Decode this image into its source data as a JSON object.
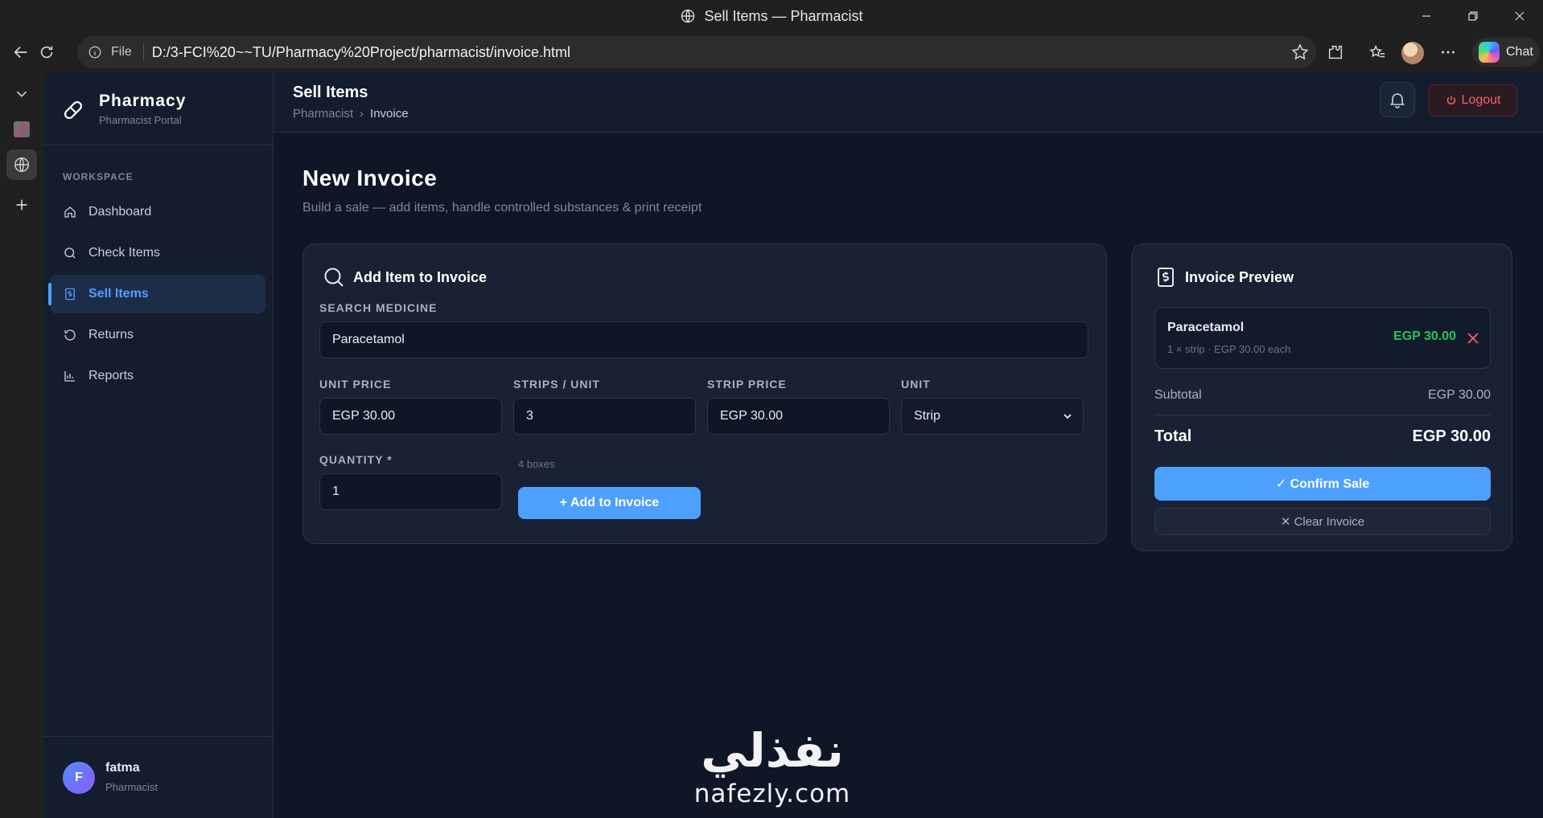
{
  "browser": {
    "window_title": "Sell Items — Pharmacist",
    "scheme_label": "File",
    "url": "D:/3-FCI%20~~TU/Pharmacy%20Project/pharmacist/invoice.html",
    "chat_label": "Chat"
  },
  "brand": {
    "name": "Pharmacy",
    "subtitle": "Pharmacist Portal"
  },
  "sidebar": {
    "section_label": "WORKSPACE",
    "items": [
      {
        "label": "Dashboard",
        "icon": "home-icon",
        "active": false
      },
      {
        "label": "Check Items",
        "icon": "search-icon",
        "active": false
      },
      {
        "label": "Sell Items",
        "icon": "receipt-icon",
        "active": true
      },
      {
        "label": "Returns",
        "icon": "undo-icon",
        "active": false
      },
      {
        "label": "Reports",
        "icon": "bar-chart-icon",
        "active": false
      }
    ],
    "user": {
      "initial": "F",
      "name": "fatma",
      "role": "Pharmacist"
    }
  },
  "topbar": {
    "title": "Sell Items",
    "breadcrumb": [
      "Pharmacist",
      "Invoice"
    ],
    "breadcrumb_sep": "›",
    "logout_label": "Logout"
  },
  "main": {
    "title": "New Invoice",
    "subtitle": "Build a sale — add items, handle controlled substances & print receipt"
  },
  "add_item": {
    "title": "Add Item to Invoice",
    "search_label": "SEARCH MEDICINE",
    "search_value": "Paracetamol",
    "unit_price_label": "UNIT PRICE",
    "unit_price_value": "EGP 30.00",
    "strips_label": "STRIPS / UNIT",
    "strips_value": "3",
    "strip_price_label": "STRIP PRICE",
    "strip_price_value": "EGP 30.00",
    "unit_label": "UNIT",
    "unit_value": "Strip",
    "quantity_label": "QUANTITY *",
    "quantity_value": "1",
    "stock_hint": "4 boxes",
    "add_button": "+ Add to Invoice"
  },
  "preview": {
    "title": "Invoice Preview",
    "item_name": "Paracetamol",
    "item_meta": "1 × strip · EGP 30.00 each",
    "item_price": "EGP 30.00",
    "subtotal_label": "Subtotal",
    "subtotal_value": "EGP 30.00",
    "total_label": "Total",
    "total_value": "EGP 30.00",
    "confirm_button": "✓ Confirm Sale",
    "clear_button": "✕ Clear Invoice"
  },
  "watermark": {
    "arabic": "نفذلي",
    "latin": "nafezly.com"
  },
  "colors": {
    "accent": "#4ea0ff",
    "success": "#22c55e",
    "danger": "#ff5c67",
    "background": "#0f1726",
    "panel": "#182234"
  }
}
